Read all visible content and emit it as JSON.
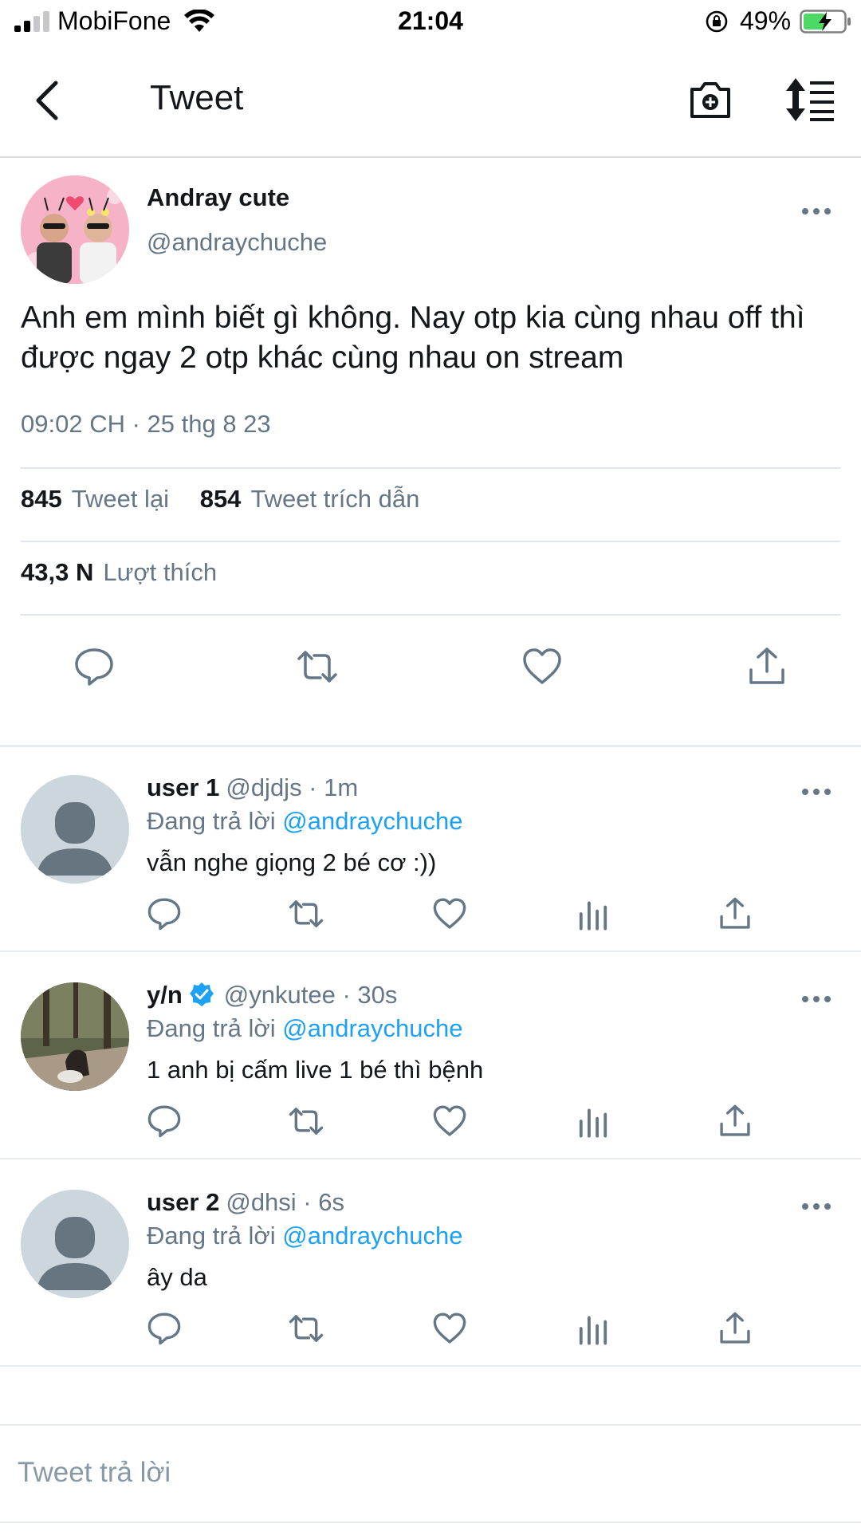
{
  "status_bar": {
    "carrier": "MobiFone",
    "time": "21:04",
    "battery_percent": "49%"
  },
  "nav": {
    "title": "Tweet"
  },
  "main_tweet": {
    "name": "Andray cute",
    "handle": "@andraychuche",
    "text": "Anh em mình biết gì không. Nay otp kia cùng nhau off thì được ngay 2 otp khác cùng nhau on stream",
    "timestamp": "09:02 CH · 25 thg 8 23",
    "retweets_count": "845",
    "retweets_label": "Tweet lại",
    "quotes_count": "854",
    "quotes_label": "Tweet trích dẫn",
    "likes_count": "43,3 N",
    "likes_label": "Lượt thích"
  },
  "replies": [
    {
      "name": "user 1",
      "handle": "@djdjs · 1m",
      "replying_prefix": "Đang trả lời",
      "replying_to": "@andraychuche",
      "text": "vẫn nghe giọng 2 bé cơ :))"
    },
    {
      "name": "y/n",
      "handle": "@ynkutee · 30s",
      "replying_prefix": "Đang trả lời",
      "replying_to": "@andraychuche",
      "text": "1 anh bị cấm live 1 bé thì bệnh"
    },
    {
      "name": "user 2",
      "handle": "@dhsi · 6s",
      "replying_prefix": "Đang trả lời",
      "replying_to": "@andraychuche",
      "text": "ây da"
    }
  ],
  "composer": {
    "placeholder": "Tweet trả lời"
  },
  "colors": {
    "accent": "#1da1f2",
    "secondary_text": "#657786",
    "primary_text": "#14171a",
    "divider": "#e6ecf0",
    "battery_green": "#4cd964"
  }
}
